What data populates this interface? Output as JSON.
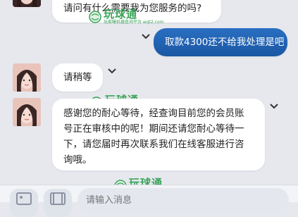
{
  "messages": [
    {
      "from": "agent",
      "text": "请问有什么需要我为您服务的吗?"
    },
    {
      "from": "user",
      "text": "取款4300还不给我处理是吧"
    },
    {
      "from": "agent",
      "text": "请稍等"
    },
    {
      "from": "agent",
      "lines": [
        "感谢您的耐心等待，经查询目前您的会员账",
        "号正在审核中的呢！期间还请您耐心等待一",
        "下，请您届时再次联系我们在线客服进行咨",
        "询哦。"
      ]
    }
  ],
  "watermark": {
    "title": "玩球通",
    "subtitle": "玩家曝机器查询平台 wqt2.com"
  },
  "input": {
    "placeholder": "请输入消息"
  },
  "colors": {
    "user_bubble": "#1f62b3",
    "background": "#e6e8ee",
    "watermark": "#3aa45a"
  },
  "icons": [
    "chevron-down-icon",
    "image-icon",
    "video-icon"
  ]
}
